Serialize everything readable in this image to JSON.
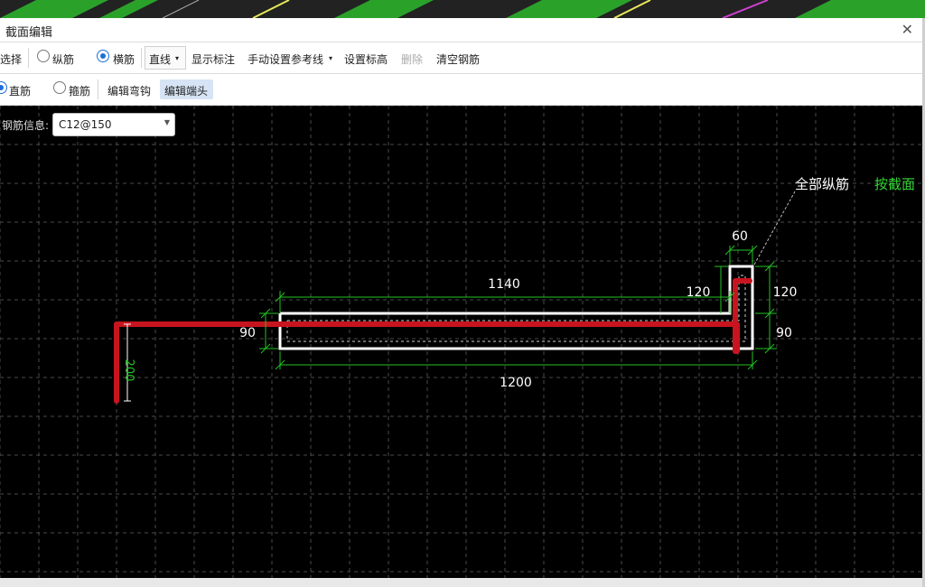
{
  "window": {
    "title": "截面编辑",
    "close_glyph": "✕"
  },
  "toolbar1": {
    "select": "选择",
    "longitudinal": "纵筋",
    "transverse": "横筋",
    "line_mode": "直线",
    "show_dims": "显示标注",
    "manual_ref": "手动设置参考线",
    "set_elev": "设置标高",
    "delete": "删除",
    "clear": "清空钢筋"
  },
  "toolbar2": {
    "straight": "直筋",
    "stirrup": "箍筋",
    "edit_hook": "编辑弯钩",
    "edit_end": "编辑端头"
  },
  "rebar_info": {
    "label": "钢筋信息:",
    "value": "C12@150"
  },
  "drawing": {
    "all_long": "全部纵筋",
    "by_section": "按截面",
    "dims": {
      "d60": "60",
      "d1140": "1140",
      "d120a": "120",
      "d120b": "120",
      "d90a": "90",
      "d90b": "90",
      "d1200": "1200",
      "d200": "200"
    }
  },
  "colors": {
    "rebar": "#c8141e",
    "dim": "#22c322",
    "outline": "#ffffff",
    "grid": "#4a4a4a",
    "accent_text": "#33d433"
  }
}
